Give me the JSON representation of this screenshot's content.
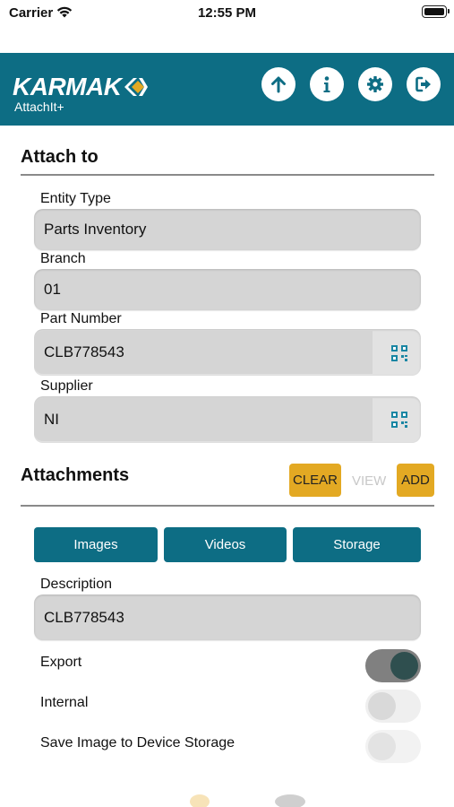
{
  "status_bar": {
    "carrier": "Carrier",
    "time": "12:55 PM"
  },
  "header": {
    "logo_text": "KARMAK",
    "subtitle": "AttachIt+",
    "background_color": "#0d6d84",
    "buttons": [
      {
        "name": "upload",
        "icon": "arrow-up-icon"
      },
      {
        "name": "info",
        "icon": "info-icon"
      },
      {
        "name": "settings",
        "icon": "gear-icon"
      },
      {
        "name": "logout",
        "icon": "logout-icon"
      }
    ]
  },
  "attach_to": {
    "title": "Attach to",
    "entity_type": {
      "label": "Entity Type",
      "value": "Parts Inventory"
    },
    "branch": {
      "label": "Branch",
      "value": "01"
    },
    "part_number": {
      "label": "Part Number",
      "value": "CLB778543"
    },
    "supplier": {
      "label": "Supplier",
      "value": "NI"
    }
  },
  "attachments": {
    "title": "Attachments",
    "clear_label": "CLEAR",
    "view_label": "VIEW",
    "add_label": "ADD",
    "accent_color": "#e3a923",
    "tabs": [
      "Images",
      "Videos",
      "Storage"
    ],
    "description": {
      "label": "Description",
      "value": "CLB778543"
    },
    "toggles": [
      {
        "label": "Export",
        "on": true
      },
      {
        "label": "Internal",
        "on": false
      },
      {
        "label": "Save Image to Device Storage",
        "on": false
      }
    ]
  }
}
